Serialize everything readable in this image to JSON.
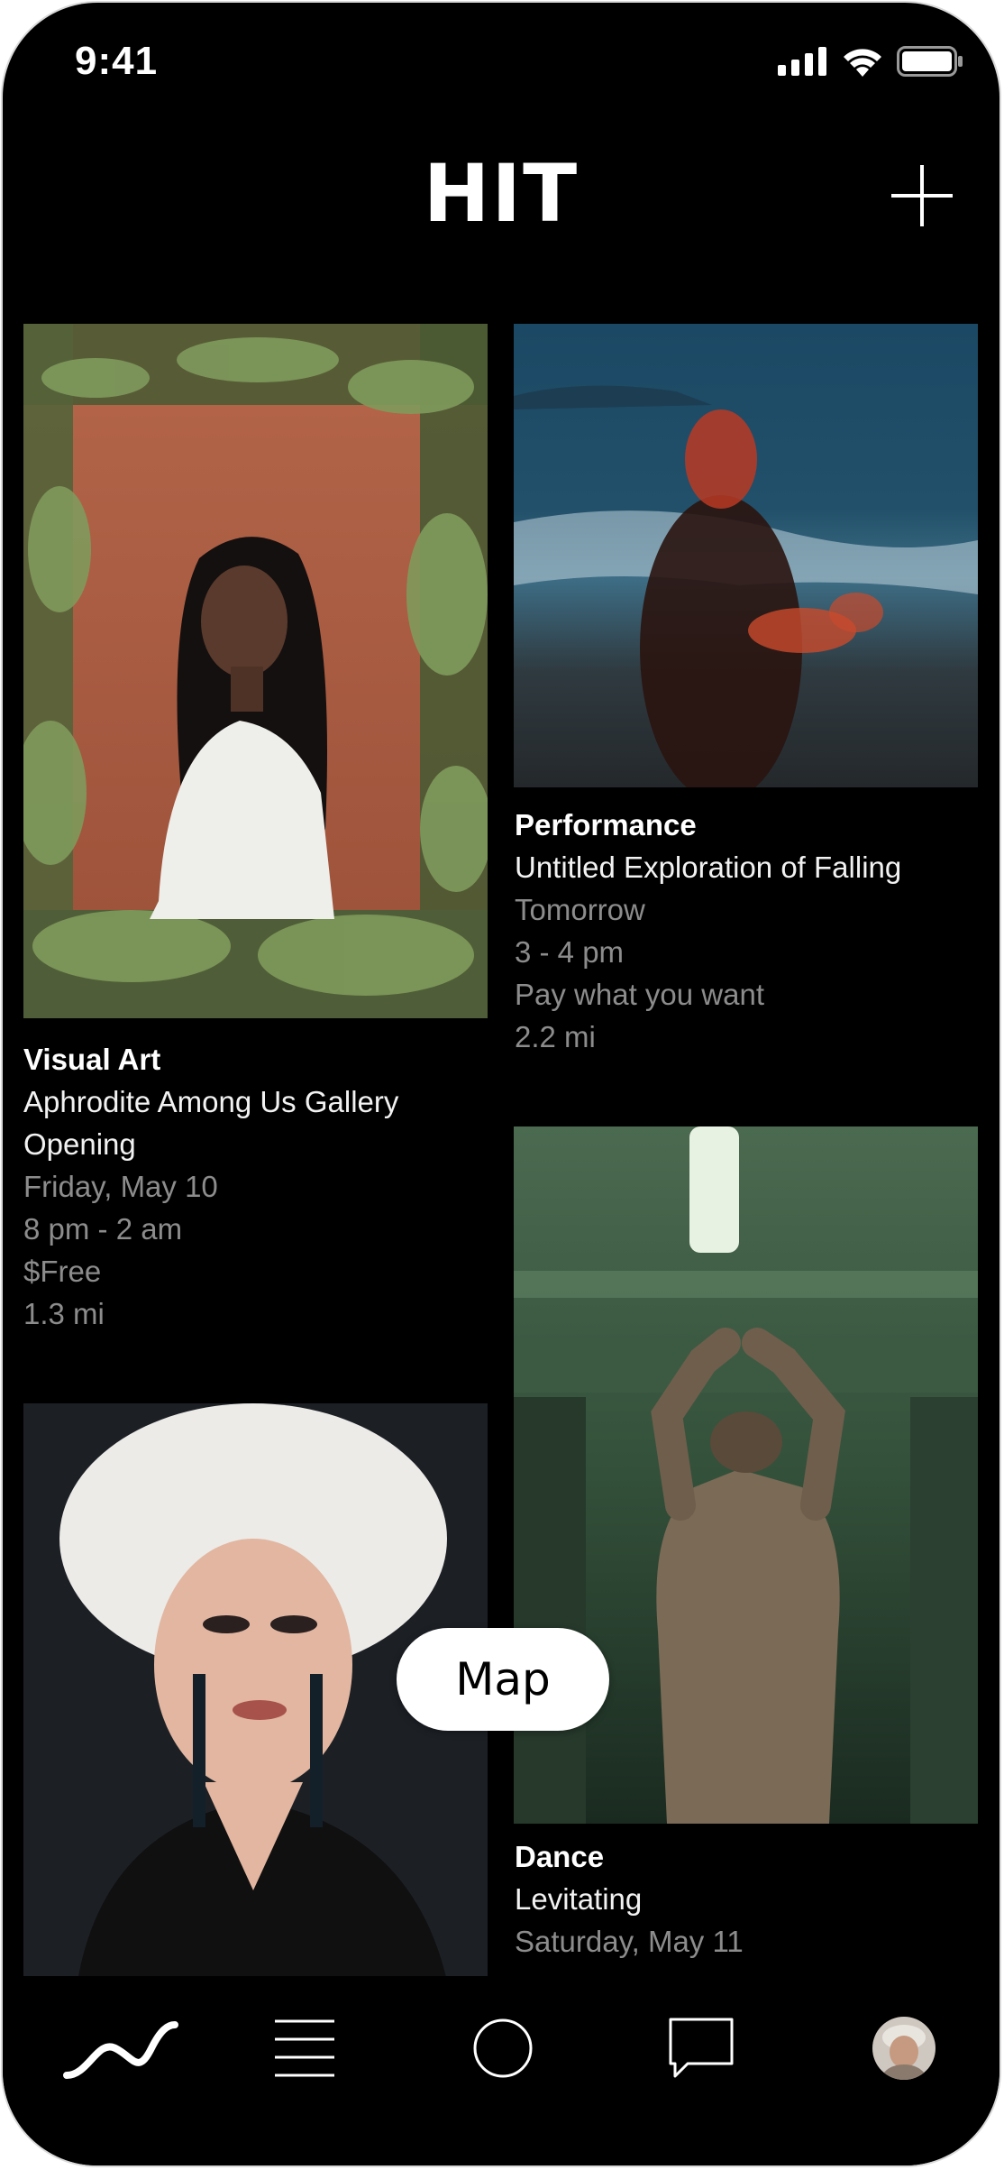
{
  "status_bar": {
    "time": "9:41"
  },
  "header": {
    "brand": "HIT",
    "add_icon": "plus-icon"
  },
  "events": [
    {
      "category": "Visual Art",
      "title_line1": "Aphrodite Among Us Gallery",
      "title_line2": "Opening",
      "date": "Friday, May 10",
      "time": "8 pm - 2 am",
      "price": "$Free",
      "distance": "1.3 mi",
      "photo": "woman-in-floral-frame-photo"
    },
    {
      "category": "Performance",
      "title": "Untitled Exploration of Falling",
      "date": "Tomorrow",
      "time": "3 - 4 pm",
      "price": "Pay what you want",
      "distance": "2.2 mi",
      "photo": "blurred-dancer-by-sea-photo"
    },
    {
      "photo": "drag-performer-white-wig-photo"
    },
    {
      "category": "Dance",
      "title": "Levitating",
      "date": "Saturday, May 11",
      "photo": "dancer-arms-raised-corridor-photo"
    }
  ],
  "map_button": {
    "label": "Map"
  },
  "tab_bar": {
    "tabs": [
      "feed-wave-icon",
      "list-menu-icon",
      "circle-icon",
      "chat-bubble-icon",
      "profile-avatar"
    ]
  },
  "colors": {
    "background": "#000000",
    "text": "#ffffff",
    "meta_text": "#8c8c8c",
    "map_button_bg": "#ffffff"
  }
}
